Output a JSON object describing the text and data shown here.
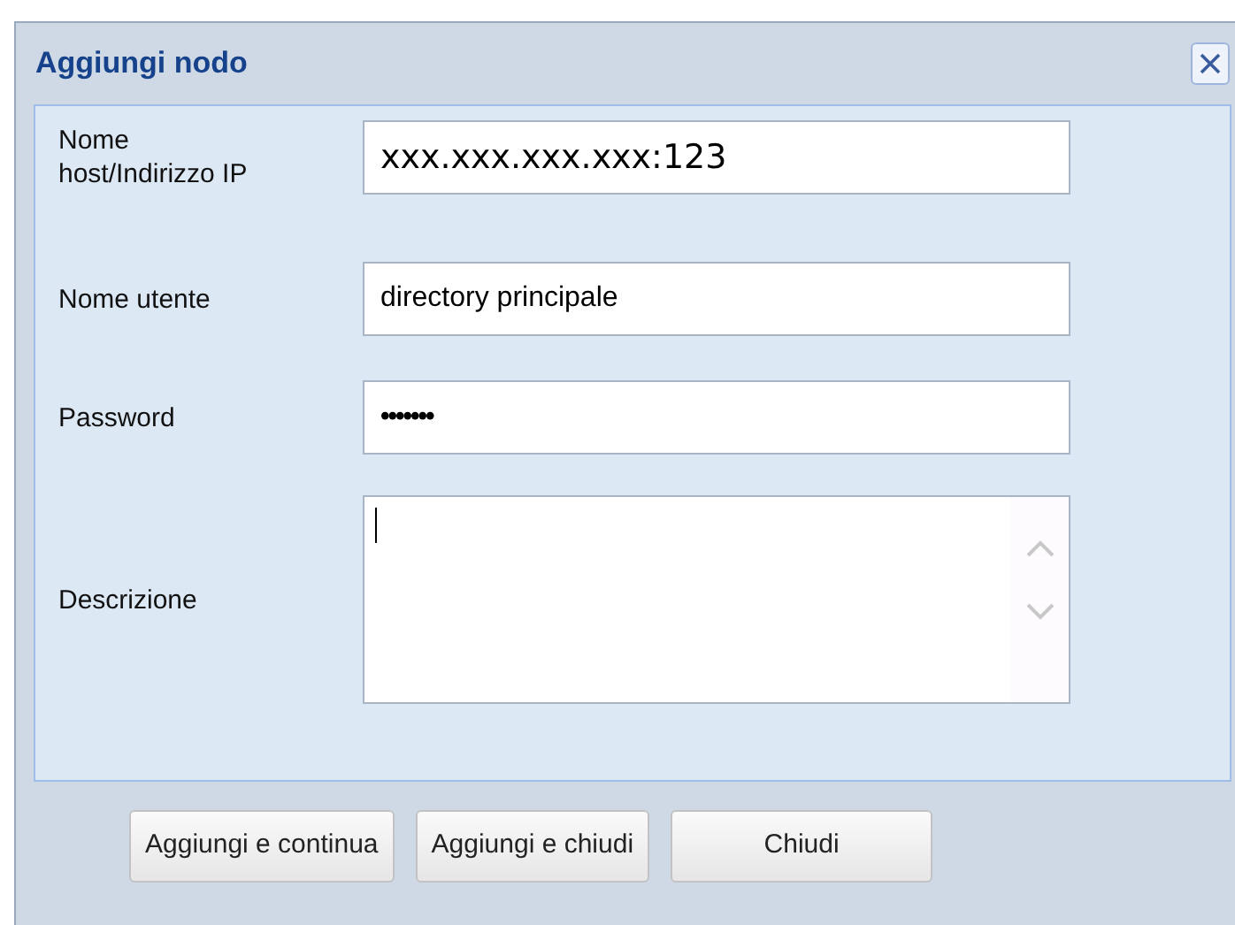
{
  "dialog": {
    "title": "Aggiungi nodo"
  },
  "fields": [
    {
      "kind": "text",
      "label": "Nome host/Indirizzo IP",
      "value": "xxx.xxx.xxx.xxx:123"
    },
    {
      "kind": "text",
      "label": "Nome utente",
      "value": "directory principale"
    },
    {
      "kind": "password",
      "label": "Password",
      "value": "•••••••"
    },
    {
      "kind": "textarea",
      "label": "Descrizione"
    }
  ],
  "buttons": [
    "Aggiungi e continua",
    "Aggiungi e chiudi",
    "Chiudi"
  ]
}
